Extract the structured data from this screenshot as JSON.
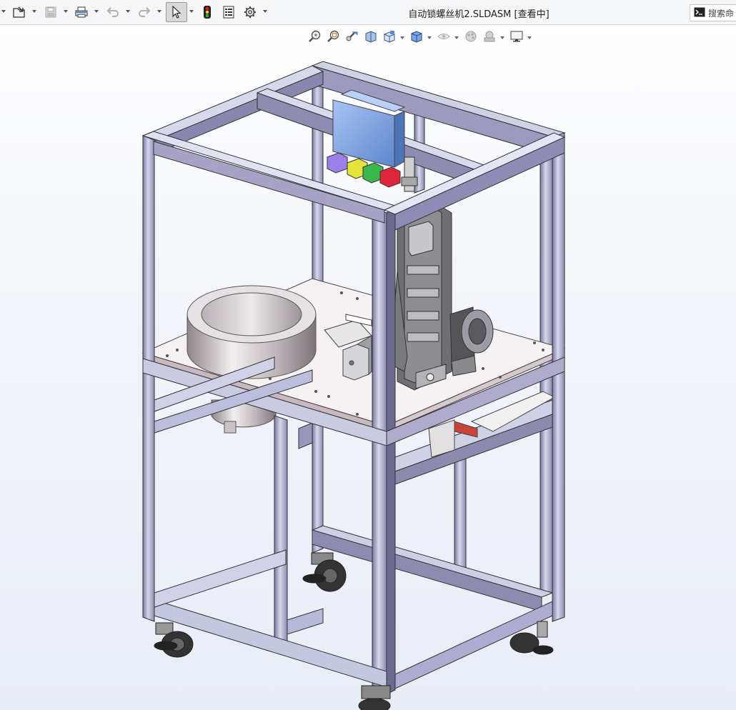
{
  "toolbar": {
    "items": [
      {
        "name": "open-icon"
      },
      {
        "name": "save-icon"
      },
      {
        "name": "print-icon"
      },
      {
        "name": "undo-icon"
      },
      {
        "name": "redo-icon"
      },
      {
        "name": "select-cursor-icon"
      },
      {
        "name": "rebuild-traffic-light-icon"
      },
      {
        "name": "file-properties-icon"
      },
      {
        "name": "options-gear-icon"
      }
    ]
  },
  "document": {
    "title": "自动锁螺丝机2.SLDASM [查看中]"
  },
  "search": {
    "label": "搜索命"
  },
  "heads_up_toolbar": {
    "items": [
      "zoom-to-fit-icon",
      "zoom-to-area-icon",
      "previous-view-icon",
      "section-view-icon",
      "view-orientation-icon",
      "display-style-icon",
      "hide-show-items-icon",
      "edit-appearance-icon",
      "apply-scene-icon",
      "view-settings-icon"
    ]
  },
  "colors": {
    "frame_light": "#c9cbe0",
    "frame_dark": "#6e6a93",
    "plate": "#f4f1f2",
    "bowl": "#c7c1c4",
    "blue_box": "#7ea6e6",
    "purple_button": "#9a80e8",
    "yellow_button": "#e5e23a",
    "green_button": "#3cb84a",
    "red_button": "#e0263c"
  }
}
